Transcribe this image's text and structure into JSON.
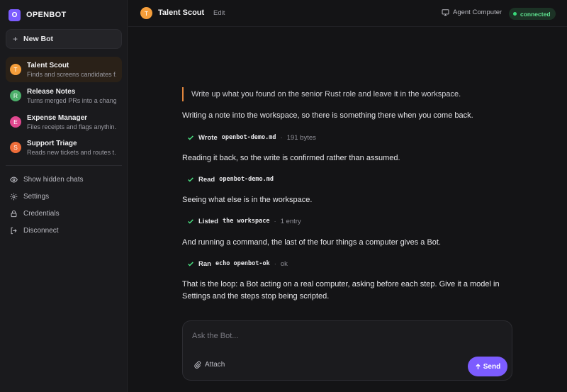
{
  "brand": {
    "logo_letter": "O",
    "name": "OPENBOT",
    "accent": "#7c5cff"
  },
  "sidebar": {
    "new_bot_label": "New Bot",
    "bots": [
      {
        "initial": "T",
        "name": "Talent Scout",
        "desc": "Finds and screens candidates f...",
        "color": "#f59e3b",
        "active": true
      },
      {
        "initial": "R",
        "name": "Release Notes",
        "desc": "Turns merged PRs into a chang...",
        "color": "#4caf6a",
        "active": false
      },
      {
        "initial": "E",
        "name": "Expense Manager",
        "desc": "Files receipts and flags anythin...",
        "color": "#e0488f",
        "active": false
      },
      {
        "initial": "S",
        "name": "Support Triage",
        "desc": "Reads new tickets and routes t...",
        "color": "#ee6d3a",
        "active": false
      }
    ],
    "menu": [
      {
        "icon": "eye-icon",
        "label": "Show hidden chats"
      },
      {
        "icon": "gear-icon",
        "label": "Settings"
      },
      {
        "icon": "lock-icon",
        "label": "Credentials"
      },
      {
        "icon": "logout-icon",
        "label": "Disconnect"
      }
    ]
  },
  "header": {
    "avatar_initial": "T",
    "title": "Talent Scout",
    "edit_label": "Edit",
    "agent_computer_label": "Agent Computer",
    "status_label": "connected"
  },
  "conversation": {
    "user_message": "Write up what you found on the senior Rust role and leave it in the workspace.",
    "messages": [
      "Writing a note into the workspace, so there is something there when you come back.",
      "Reading it back, so the write is confirmed rather than assumed.",
      "Seeing what else is in the workspace.",
      "And running a command, the last of the four things a computer gives a Bot.",
      "That is the loop: a Bot acting on a real computer, asking before each step. Give it a model in Settings and the steps stop being scripted."
    ],
    "steps": [
      {
        "verb": "Wrote",
        "target": "openbot-demo.md",
        "meta": "191 bytes"
      },
      {
        "verb": "Read",
        "target": "openbot-demo.md",
        "meta": ""
      },
      {
        "verb": "Listed",
        "target": "the workspace",
        "meta": "1 entry"
      },
      {
        "verb": "Ran",
        "target": "echo openbot-ok",
        "meta": "ok"
      }
    ]
  },
  "composer": {
    "placeholder": "Ask the Bot...",
    "attach_label": "Attach",
    "send_label": "Send"
  }
}
